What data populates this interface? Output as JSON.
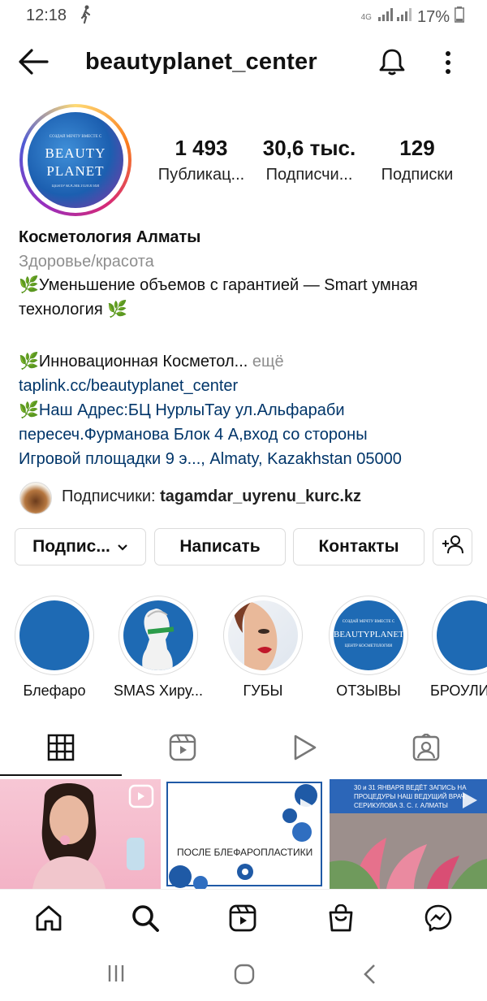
{
  "status_bar": {
    "time": "12:18",
    "network": "4G",
    "battery": "17%"
  },
  "header": {
    "username": "beautyplanet_center"
  },
  "avatar": {
    "line_top": "СОЗДАЙ МЕЧТУ ВМЕСТЕ С",
    "line1": "BEAUTY",
    "line2": "PLANET",
    "line_bottom": "ЦЕНТР КОСМЕТОЛОГИИ"
  },
  "stats": [
    {
      "value": "1 493",
      "label": "Публикац..."
    },
    {
      "value": "30,6 тыс.",
      "label": "Подписчи..."
    },
    {
      "value": "129",
      "label": "Подписки"
    }
  ],
  "bio": {
    "name": "Косметология Алматы",
    "category": "Здоровье/красота",
    "line1": "🌿Уменьшение объемов с гарантией — Smart умная",
    "line2": "технология 🌿",
    "line3": "🌿Инновационная Косметол...",
    "more": "ещё",
    "website": "taplink.cc/beautyplanet_center",
    "address1": "🌿Наш Адрес:БЦ НурлыТау ул.Альфараби",
    "address2": "пересеч.Фурманова Блок 4 А,вход со стороны",
    "address3": "Игровой площадки 9 э..., Almaty, Kazakhstan 05000"
  },
  "followed_by": {
    "prefix": "Подписчики:",
    "account": "tagamdar_uyrenu_kurc.kz"
  },
  "buttons": {
    "follow": "Подпис...",
    "message": "Написать",
    "contacts": "Контакты"
  },
  "highlights": [
    {
      "label": "Блефаро"
    },
    {
      "label": "SMAS Хиру..."
    },
    {
      "label": "ГУБЫ"
    },
    {
      "label": "ОТЗЫВЫ",
      "img_text": "BEAUTYPLANET",
      "img_top": "СОЗДАЙ МЕЧТУ ВМЕСТЕ С",
      "img_bottom": "ЦЕНТР КОСМЕТОЛОГИИ"
    },
    {
      "label": "БРОУЛИ"
    }
  ],
  "grid": {
    "post2_text": "ПОСЛЕ БЛЕФАРОПЛАСТИКИ",
    "post3_text1": "30 и 31 ЯНВАРЯ ВЕДЁТ ЗАПИСЬ НА",
    "post3_text2": "ПРОЦЕДУРЫ НАШ ВЕДУЩИЙ ВРАЧ",
    "post3_text3": "СЕРИКУЛОВА З. С. г. АЛМАТЫ"
  },
  "colors": {
    "link": "#003569",
    "muted": "#8e8e8e",
    "border": "#dbdbdb",
    "highlight_blue": "#1e6ab4"
  }
}
